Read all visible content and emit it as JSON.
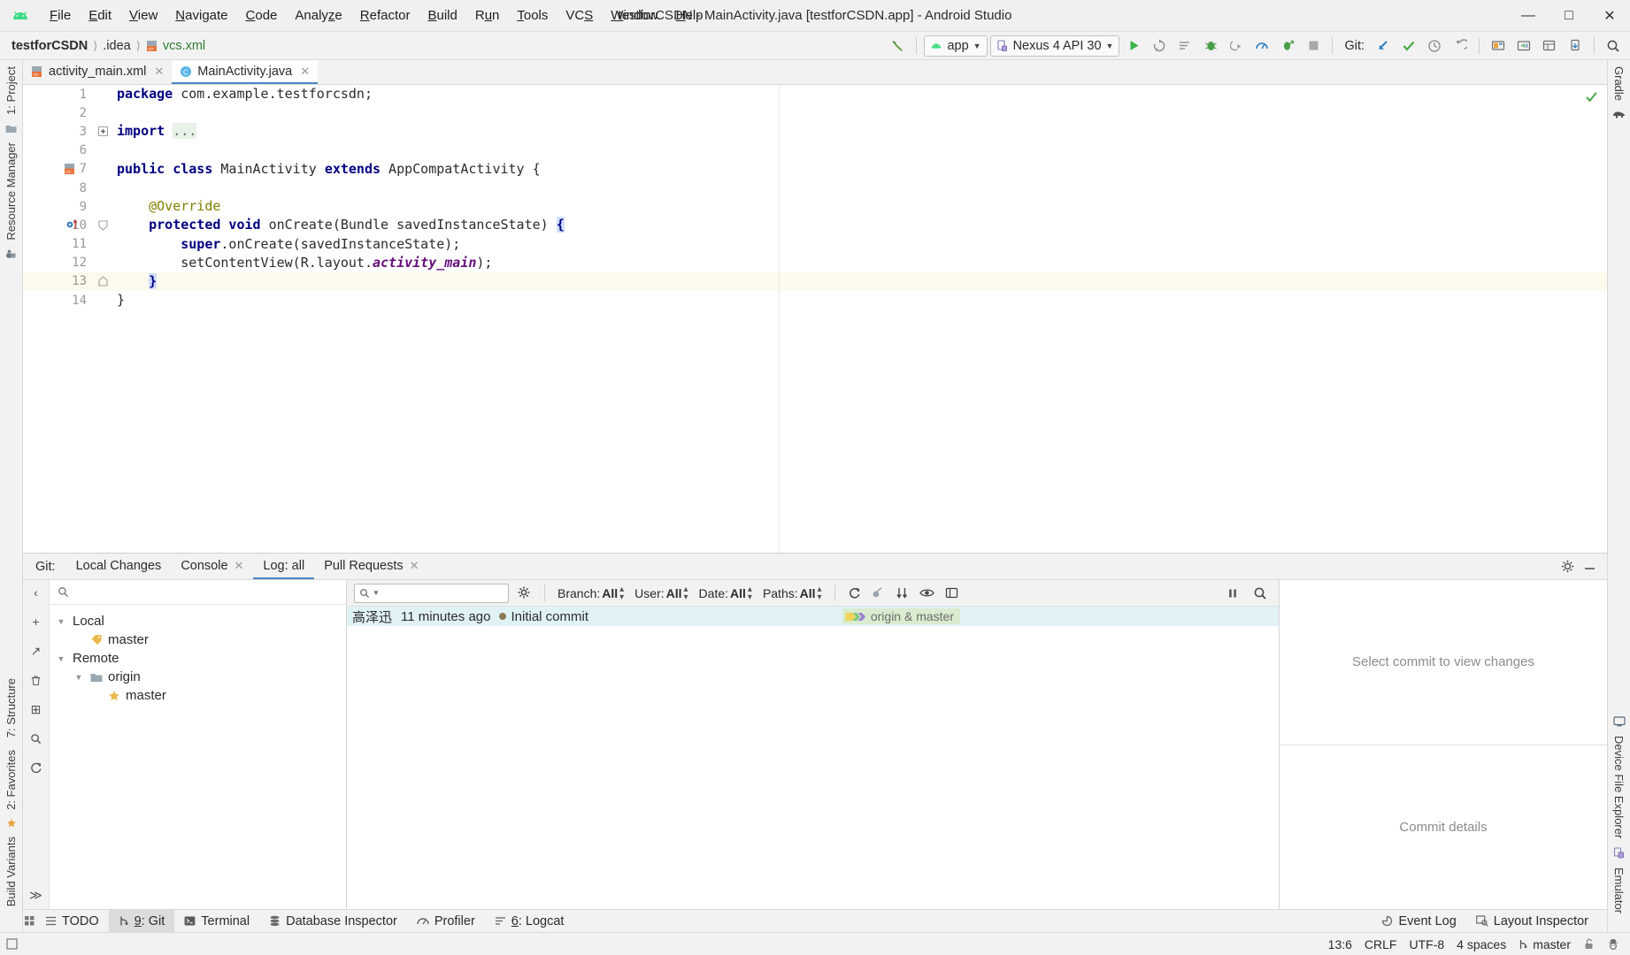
{
  "window": {
    "title": "testforCSDN - MainActivity.java [testforCSDN.app] - Android Studio",
    "minimize": "—",
    "maximize": "□",
    "close": "✕"
  },
  "menu": {
    "items": [
      {
        "label": "File",
        "mnemonic": "F"
      },
      {
        "label": "Edit",
        "mnemonic": "E"
      },
      {
        "label": "View",
        "mnemonic": "V"
      },
      {
        "label": "Navigate",
        "mnemonic": "N"
      },
      {
        "label": "Code",
        "mnemonic": "C"
      },
      {
        "label": "Analyze",
        "mnemonic": "z"
      },
      {
        "label": "Refactor",
        "mnemonic": "R"
      },
      {
        "label": "Build",
        "mnemonic": "B"
      },
      {
        "label": "Run",
        "mnemonic": "u"
      },
      {
        "label": "Tools",
        "mnemonic": "T"
      },
      {
        "label": "VCS",
        "mnemonic": "S"
      },
      {
        "label": "Window",
        "mnemonic": "W"
      },
      {
        "label": "Help",
        "mnemonic": "H"
      }
    ]
  },
  "navbar": {
    "breadcrumbs": [
      "testforCSDN",
      ".idea",
      "vcs.xml"
    ],
    "separator": "〉",
    "run_config": "app",
    "device": "Nexus 4 API 30",
    "git_label": "Git:"
  },
  "editor": {
    "tabs": [
      {
        "label": "activity_main.xml",
        "active": false,
        "icon": "xml-layout-icon"
      },
      {
        "label": "MainActivity.java",
        "active": true,
        "icon": "java-class-icon"
      }
    ],
    "line_numbers": [
      "1",
      "2",
      "3",
      "6",
      "7",
      "8",
      "9",
      "10",
      "11",
      "12",
      "13",
      "14"
    ],
    "lines": [
      {
        "num": "1",
        "tokens": [
          {
            "t": "package",
            "c": "kw"
          },
          {
            "t": " com.example.testforcsdn;",
            "c": "plain"
          }
        ]
      },
      {
        "num": "2",
        "tokens": []
      },
      {
        "num": "3",
        "tokens": [
          {
            "t": "import",
            "c": "kw"
          },
          {
            "t": " ",
            "c": "plain"
          },
          {
            "t": "...",
            "c": "folded"
          }
        ]
      },
      {
        "num": "6",
        "tokens": []
      },
      {
        "num": "7",
        "tokens": [
          {
            "t": "public class",
            "c": "kw"
          },
          {
            "t": " MainActivity ",
            "c": "plain"
          },
          {
            "t": "extends",
            "c": "kw"
          },
          {
            "t": " AppCompatActivity {",
            "c": "plain"
          }
        ]
      },
      {
        "num": "8",
        "tokens": []
      },
      {
        "num": "9",
        "tokens": [
          {
            "t": "    @Override",
            "c": "anno"
          }
        ]
      },
      {
        "num": "10",
        "tokens": [
          {
            "t": "    protected void",
            "c": "kw"
          },
          {
            "t": " onCreate(Bundle savedInstanceState) ",
            "c": "plain"
          },
          {
            "t": "{",
            "c": "brace"
          }
        ]
      },
      {
        "num": "11",
        "tokens": [
          {
            "t": "        super",
            "c": "kw"
          },
          {
            "t": ".onCreate(savedInstanceState);",
            "c": "plain"
          }
        ]
      },
      {
        "num": "12",
        "tokens": [
          {
            "t": "        setContentView(R.layout.",
            "c": "plain"
          },
          {
            "t": "activity_main",
            "c": "fld"
          },
          {
            "t": ");",
            "c": "plain"
          }
        ]
      },
      {
        "num": "13",
        "tokens": [
          {
            "t": "    ",
            "c": "plain"
          },
          {
            "t": "}",
            "c": "brace"
          }
        ],
        "highlight": true
      },
      {
        "num": "14",
        "tokens": [
          {
            "t": "}",
            "c": "plain"
          }
        ]
      }
    ],
    "inspection_status": "ok"
  },
  "left_rail": {
    "tabs": [
      {
        "label": "1: Project",
        "icon": "project-folder-icon"
      },
      {
        "label": "Resource Manager",
        "icon": "resource-manager-icon"
      }
    ],
    "bottom_tabs": [
      {
        "label": "7: Structure",
        "icon": "structure-icon"
      },
      {
        "label": "2: Favorites",
        "icon": "star-icon"
      },
      {
        "label": "Build Variants",
        "icon": "build-variants-icon"
      }
    ]
  },
  "right_rail": {
    "tabs": [
      {
        "label": "Gradle",
        "icon": "gradle-elephant-icon"
      }
    ],
    "bottom_tabs": [
      {
        "label": "Device File Explorer",
        "icon": "device-file-explorer-icon"
      },
      {
        "label": "Emulator",
        "icon": "emulator-icon"
      }
    ]
  },
  "git_window": {
    "title": "Git:",
    "tabs": [
      {
        "label": "Local Changes",
        "active": false,
        "closable": false
      },
      {
        "label": "Console",
        "active": false,
        "closable": true
      },
      {
        "label": "Log: all",
        "active": true,
        "closable": false
      },
      {
        "label": "Pull Requests",
        "active": false,
        "closable": true
      }
    ],
    "branch_tree": [
      {
        "label": "Local",
        "depth": 0,
        "expander": "▼",
        "icon": "none"
      },
      {
        "label": "master",
        "depth": 1,
        "expander": "",
        "icon": "tag-icon"
      },
      {
        "label": "Remote",
        "depth": 0,
        "expander": "▼",
        "icon": "none"
      },
      {
        "label": "origin",
        "depth": 1,
        "expander": "▼",
        "icon": "folder-icon"
      },
      {
        "label": "master",
        "depth": 2,
        "expander": "",
        "icon": "star-icon"
      }
    ],
    "branch_search_placeholder": "",
    "log_search_placeholder": "",
    "filters": [
      {
        "label": "Branch:",
        "value": "All"
      },
      {
        "label": "User:",
        "value": "All"
      },
      {
        "label": "Date:",
        "value": "All"
      },
      {
        "label": "Paths:",
        "value": "All"
      }
    ],
    "commits": [
      {
        "author": "高泽迅",
        "time": "11 minutes ago",
        "message": "Initial commit",
        "ref": "origin & master",
        "selected": true
      }
    ],
    "detail_top_placeholder": "Select commit to view changes",
    "detail_bottom_placeholder": "Commit details"
  },
  "bottom_tabs": {
    "items": [
      {
        "label": "TODO",
        "icon": "todo-icon",
        "active": false,
        "mnemonic": ""
      },
      {
        "label": "9: Git",
        "icon": "git-branch-icon",
        "active": true,
        "mnemonic": "9"
      },
      {
        "label": "Terminal",
        "icon": "terminal-icon",
        "active": false,
        "mnemonic": ""
      },
      {
        "label": "Database Inspector",
        "icon": "database-icon",
        "active": false,
        "mnemonic": ""
      },
      {
        "label": "Profiler",
        "icon": "profiler-icon",
        "active": false,
        "mnemonic": ""
      },
      {
        "label": "6: Logcat",
        "icon": "logcat-icon",
        "active": false,
        "mnemonic": "6"
      }
    ],
    "right_items": [
      {
        "label": "Event Log",
        "icon": "event-log-icon"
      },
      {
        "label": "Layout Inspector",
        "icon": "layout-inspector-icon"
      }
    ]
  },
  "statusbar": {
    "caret_position": "13:6",
    "line_separator": "CRLF",
    "encoding": "UTF-8",
    "indent": "4 spaces",
    "branch": "master",
    "lock_icon": "unlocked-icon",
    "inspection_icon": "hector-icon"
  },
  "colors": {
    "accent_blue": "#4a88c7",
    "android_green": "#3ddc84",
    "keyword_navy": "#000080",
    "annotation_olive": "#808000",
    "field_purple": "#660e7a",
    "selection_cyan": "#e1f2f7",
    "ref_green": "#d9ecd0",
    "highlight_line": "#fcfaed"
  }
}
